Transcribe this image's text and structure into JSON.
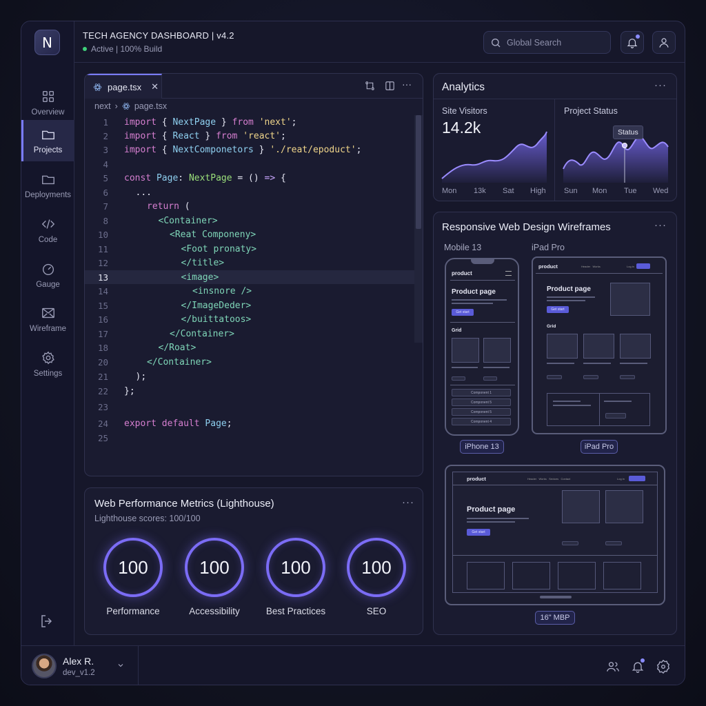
{
  "header": {
    "logo_letter": "N",
    "title": "TECH AGENCY DASHBOARD | v4.2",
    "status": "Active | 100% Build",
    "search_placeholder": "Global Search"
  },
  "sidebar": {
    "items": [
      {
        "label": "Overview",
        "icon": "grid-icon"
      },
      {
        "label": "Projects",
        "icon": "folder-icon",
        "active": true
      },
      {
        "label": "Deployments",
        "icon": "folder-icon"
      },
      {
        "label": "Code",
        "icon": "code-icon"
      },
      {
        "label": "Gauge",
        "icon": "gauge-icon"
      },
      {
        "label": "Wireframe",
        "icon": "wireframe-icon"
      },
      {
        "label": "Settings",
        "icon": "gear-icon"
      }
    ]
  },
  "editor": {
    "tab": "page.tsx",
    "breadcrumb": [
      "next",
      "page.tsx"
    ],
    "current_line": 13,
    "lines": [
      {
        "n": "1",
        "indent": 0,
        "tokens": [
          [
            "kw",
            "import "
          ],
          [
            "p",
            "{ "
          ],
          [
            "id",
            "NextPage"
          ],
          [
            "p",
            " } "
          ],
          [
            "kw",
            "from "
          ],
          [
            "s",
            "'next'"
          ],
          [
            "p",
            ";"
          ]
        ]
      },
      {
        "n": "2",
        "indent": 0,
        "tokens": [
          [
            "kw",
            "import "
          ],
          [
            "p",
            "{ "
          ],
          [
            "id",
            "React"
          ],
          [
            "p",
            " } "
          ],
          [
            "kw",
            "from "
          ],
          [
            "s",
            "'react'"
          ],
          [
            "p",
            ";"
          ]
        ]
      },
      {
        "n": "3",
        "indent": 0,
        "tokens": [
          [
            "kw",
            "import "
          ],
          [
            "p",
            "{ "
          ],
          [
            "id",
            "NextComponetors"
          ],
          [
            "p",
            " } "
          ],
          [
            "s",
            "'./reat/epoduct'"
          ],
          [
            "p",
            ";"
          ]
        ]
      },
      {
        "n": "4",
        "indent": 0,
        "tokens": []
      },
      {
        "n": "5",
        "indent": 0,
        "tokens": [
          [
            "kw",
            "const "
          ],
          [
            "id",
            "Page"
          ],
          [
            "p",
            ": "
          ],
          [
            "tp",
            "NextPage"
          ],
          [
            "p",
            " = () "
          ],
          [
            "op",
            "=>"
          ],
          [
            "p",
            " {"
          ]
        ]
      },
      {
        "n": "6",
        "indent": 1,
        "tokens": [
          [
            "p",
            "..."
          ]
        ]
      },
      {
        "n": "7",
        "indent": 2,
        "tokens": [
          [
            "kw",
            "return"
          ],
          [
            "p",
            " ("
          ]
        ]
      },
      {
        "n": "8",
        "indent": 3,
        "tokens": [
          [
            "tg",
            "<Container>"
          ]
        ]
      },
      {
        "n": "10",
        "indent": 4,
        "tokens": [
          [
            "tg",
            "<Reat Componeny>"
          ]
        ]
      },
      {
        "n": "11",
        "indent": 5,
        "tokens": [
          [
            "tg",
            "<Foot pronaty>"
          ]
        ]
      },
      {
        "n": "12",
        "indent": 5,
        "tokens": [
          [
            "tg",
            "</title>"
          ]
        ]
      },
      {
        "n": "13",
        "indent": 5,
        "tokens": [
          [
            "tg",
            "<image>"
          ]
        ]
      },
      {
        "n": "14",
        "indent": 6,
        "tokens": [
          [
            "tg",
            "<insnore />"
          ]
        ]
      },
      {
        "n": "15",
        "indent": 5,
        "tokens": [
          [
            "tg",
            "</ImageDeder>"
          ]
        ]
      },
      {
        "n": "16",
        "indent": 5,
        "tokens": [
          [
            "tg",
            "</buittatoos>"
          ]
        ]
      },
      {
        "n": "17",
        "indent": 4,
        "tokens": [
          [
            "tg",
            "</Container>"
          ]
        ]
      },
      {
        "n": "18",
        "indent": 3,
        "tokens": [
          [
            "tg",
            "</Roat>"
          ]
        ]
      },
      {
        "n": "20",
        "indent": 2,
        "tokens": [
          [
            "tg",
            "</Container>"
          ]
        ]
      },
      {
        "n": "21",
        "indent": 1,
        "tokens": [
          [
            "p",
            ");"
          ]
        ]
      },
      {
        "n": "22",
        "indent": 0,
        "tokens": [
          [
            "p",
            "};"
          ]
        ]
      },
      {
        "n": "23",
        "indent": 0,
        "tokens": []
      },
      {
        "n": "24",
        "indent": 0,
        "tokens": [
          [
            "kw",
            "export "
          ],
          [
            "kw",
            "default "
          ],
          [
            "id",
            "Page"
          ],
          [
            "p",
            ";"
          ]
        ]
      },
      {
        "n": "25",
        "indent": 0,
        "tokens": []
      }
    ]
  },
  "lighthouse": {
    "title": "Web Performance Metrics (Lighthouse)",
    "subtitle": "Lighthouse scores: 100/100",
    "scores": [
      {
        "value": "100",
        "label": "Performance"
      },
      {
        "value": "100",
        "label": "Accessibility"
      },
      {
        "value": "100",
        "label": "Best Practices"
      },
      {
        "value": "100",
        "label": "SEO"
      }
    ]
  },
  "analytics": {
    "title": "Analytics",
    "visitors": {
      "label": "Site Visitors",
      "value": "14.2k",
      "axis": [
        "Mon",
        "13k",
        "Sat",
        "High"
      ]
    },
    "status": {
      "label": "Project Status",
      "tooltip": "Status",
      "axis": [
        "Sun",
        "Mon",
        "Tue",
        "Wed"
      ]
    }
  },
  "wireframes": {
    "title": "Responsive Web Design Wireframes",
    "mobile_label": "Mobile 13",
    "tablet_label": "iPad Pro",
    "mobile_pill": "iPhone 13",
    "tablet_pill": "iPad Pro",
    "laptop_pill": "16\" MBP",
    "brand": "product",
    "page_title": "Product page",
    "grid_label": "Grid",
    "components": [
      "Component 1",
      "Component 5",
      "Component 5",
      "Component 4"
    ],
    "nav": [
      "Header",
      "Works",
      "Sevices",
      "Contact"
    ],
    "login": "Log in",
    "cta": "Get start"
  },
  "footer": {
    "user_name": "Alex R.",
    "user_sub": "dev_v1.2"
  },
  "colors": {
    "accent": "#7a7cff",
    "keyword": "#d67fd0",
    "identifier": "#8fd0f0",
    "string": "#f0d58a",
    "tag": "#7fd6b8",
    "type": "#9be07a",
    "status_green": "#3fd07a"
  }
}
